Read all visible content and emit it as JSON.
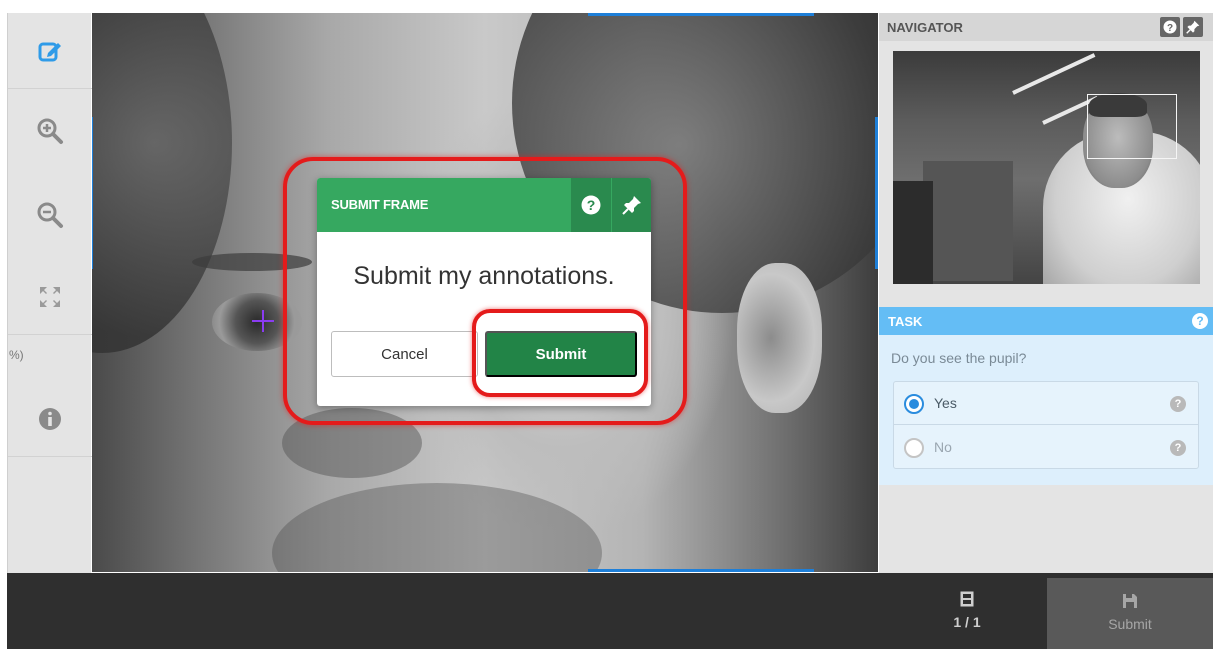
{
  "toolbar": {
    "tools": [
      {
        "name": "annotate-tool",
        "icon": "edit-square-icon",
        "active": true
      },
      {
        "name": "zoom-in-tool",
        "icon": "zoom-in-icon"
      },
      {
        "name": "zoom-out-tool",
        "icon": "zoom-out-icon"
      },
      {
        "name": "fit-tool",
        "icon": "expand-arrows-icon"
      },
      {
        "name": "info-tool",
        "icon": "info-icon"
      }
    ],
    "zoom_readout": "%)"
  },
  "dialog": {
    "title": "SUBMIT FRAME",
    "help_icon": "question-icon",
    "pin_icon": "pin-icon",
    "message": "Submit my annotations.",
    "cancel_label": "Cancel",
    "submit_label": "Submit"
  },
  "navigator": {
    "title": "NAVIGATOR",
    "help_icon": "question-icon",
    "pin_icon": "pin-icon"
  },
  "task": {
    "title": "TASK",
    "question": "Do you see the pupil?",
    "options": [
      {
        "label": "Yes",
        "checked": true
      },
      {
        "label": "No",
        "checked": false
      }
    ]
  },
  "bottom_bar": {
    "frame_counter": "1 / 1",
    "frame_icon": "film-frame-icon",
    "submit_label": "Submit",
    "submit_icon": "save-icon"
  },
  "colors": {
    "accent_blue": "#1e7fd8",
    "dialog_green": "#36a860",
    "submit_green": "#228447",
    "highlight_red": "#e41b1b",
    "task_blue": "#64bdf5"
  }
}
